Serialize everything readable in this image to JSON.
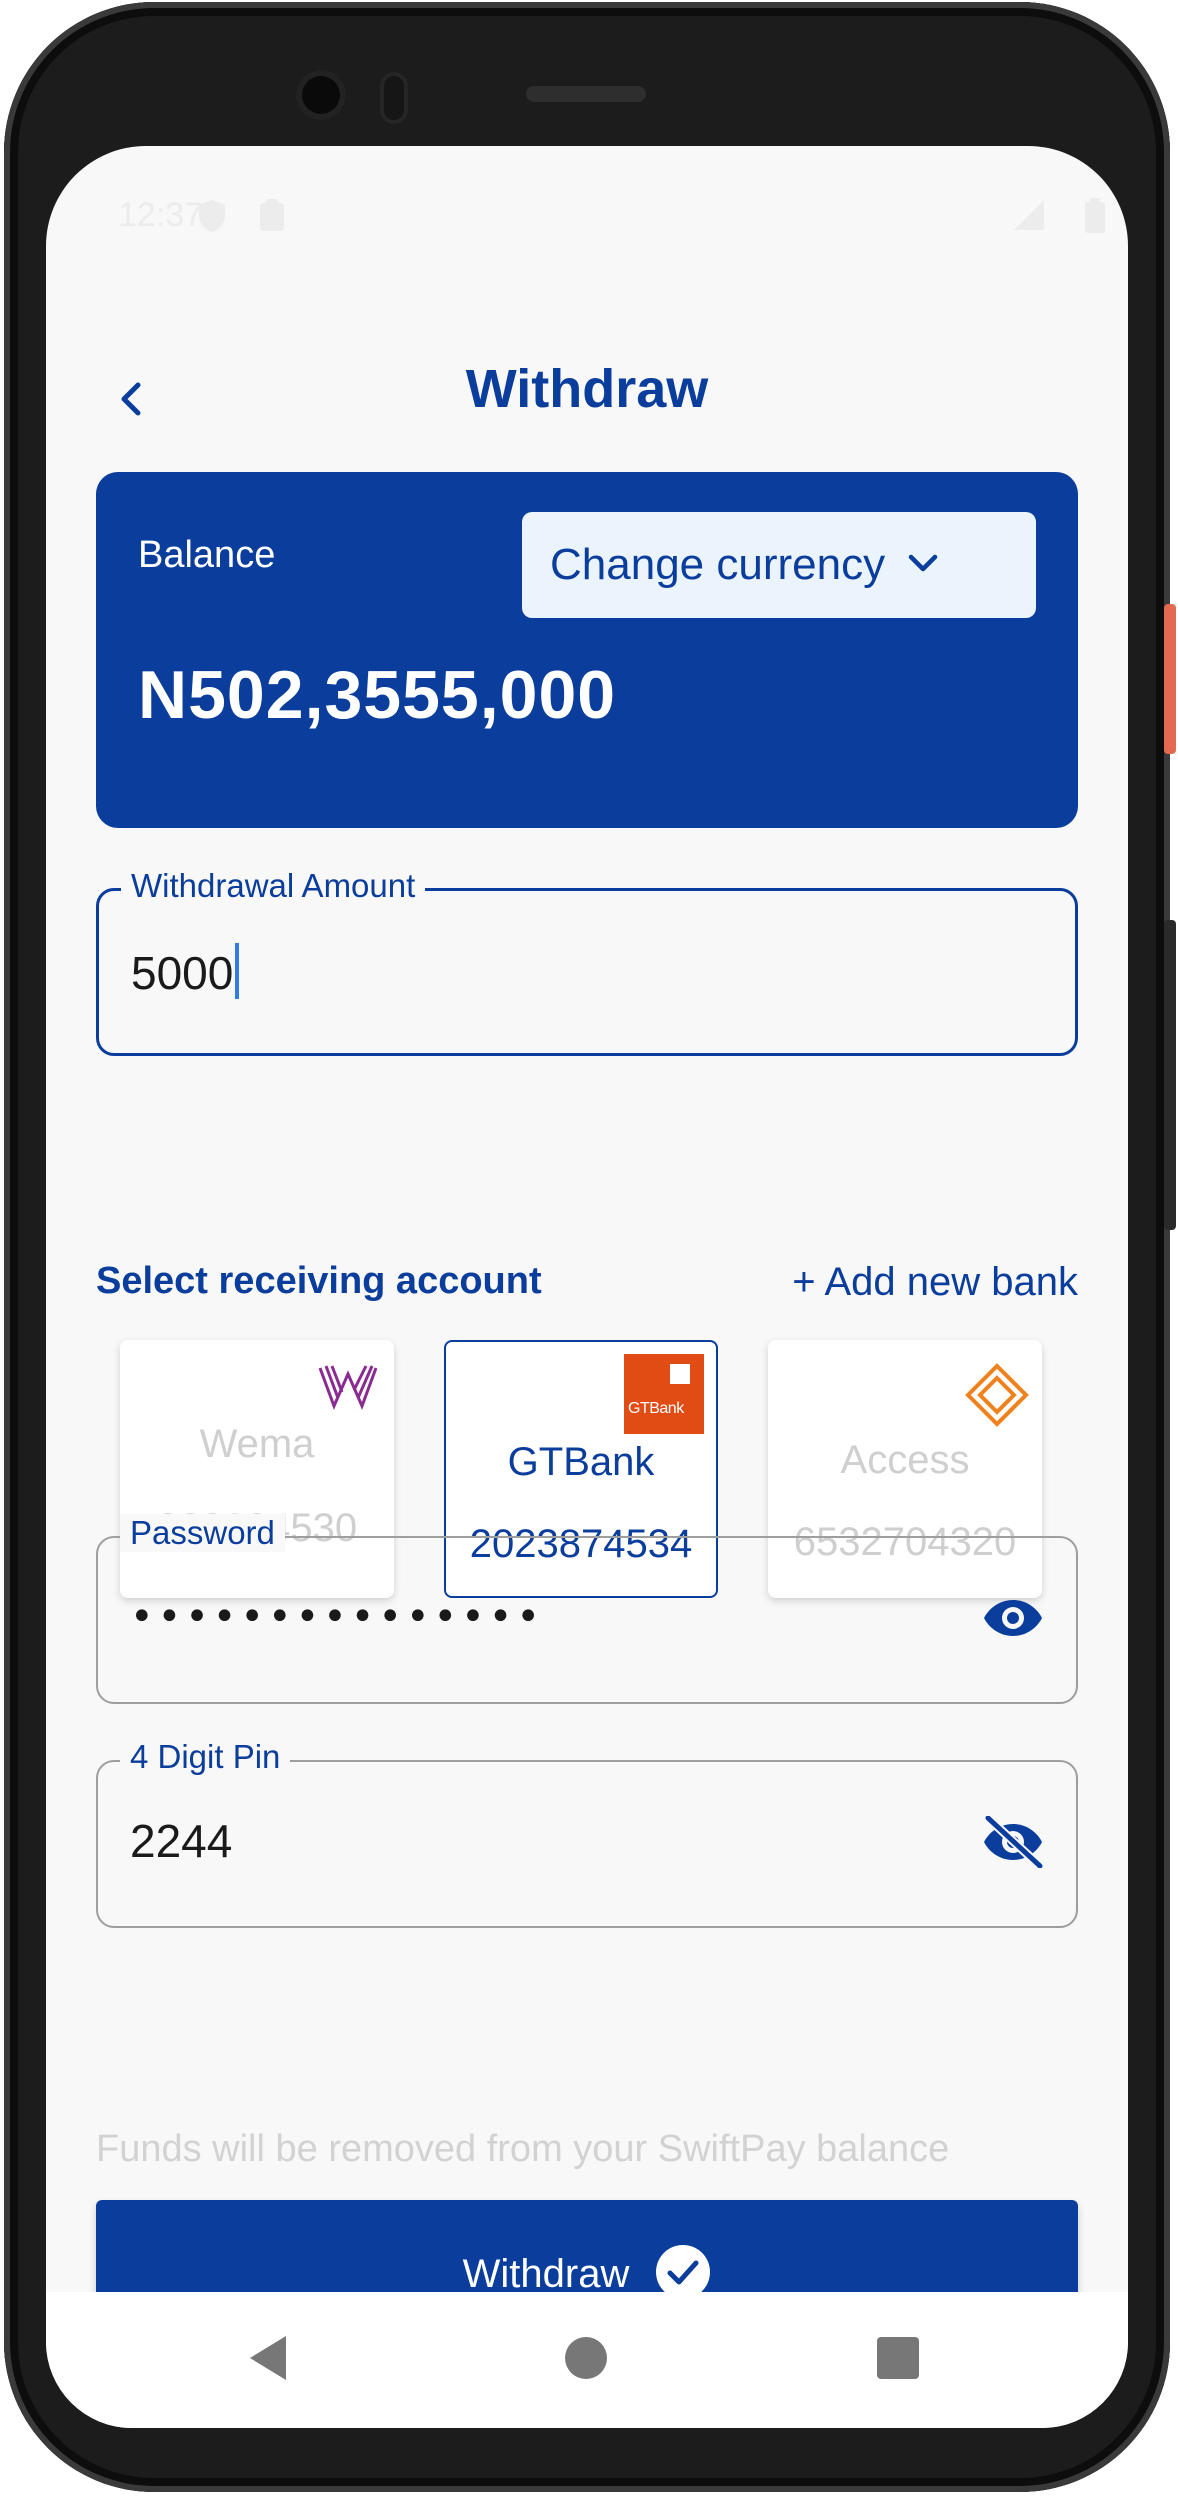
{
  "status_bar": {
    "time": "12:37"
  },
  "header": {
    "title": "Withdraw",
    "back_icon": "chevron-left-icon"
  },
  "balance_card": {
    "label": "Balance",
    "amount": "N502,3555,000",
    "currency_button_label": "Change currency"
  },
  "withdrawal_amount": {
    "label": "Withdrawal Amount",
    "value": "5000"
  },
  "receiving_account": {
    "title": "Select receiving account",
    "add_bank_label": "+ Add new bank",
    "banks": [
      {
        "name": "Wema",
        "number": "323894530",
        "selected": false
      },
      {
        "name": "GTBank",
        "number": "2023874534",
        "selected": true,
        "logo_text": "GTBank"
      },
      {
        "name": "Access",
        "number": "6532704320",
        "selected": false
      }
    ]
  },
  "password": {
    "label": "Password",
    "masked_value": "•••••••••••••••"
  },
  "pin": {
    "label": "4 Digit Pin",
    "value": "2244"
  },
  "note": "Funds will be removed from your SwiftPay balance",
  "withdraw_button": {
    "label": "Withdraw"
  },
  "colors": {
    "primary": "#0a3d9c",
    "currency_bg": "#ebf4fc",
    "gtbank": "#e14b14",
    "wema": "#8b2a8f",
    "access": "#f0821e",
    "caret": "#2f7fe0"
  }
}
